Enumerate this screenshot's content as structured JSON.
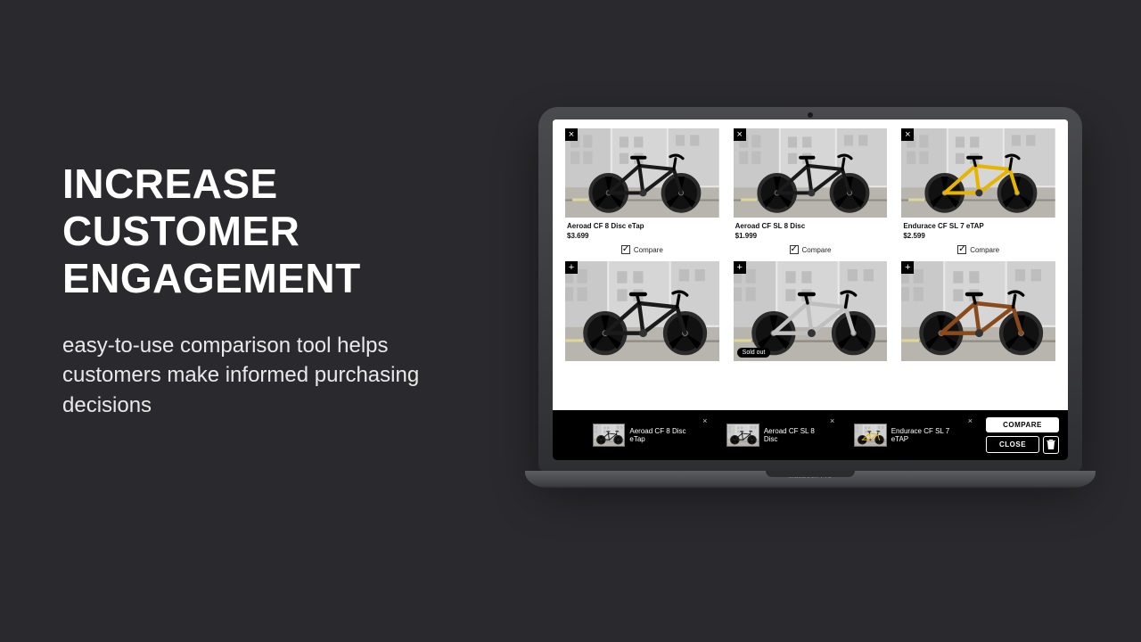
{
  "marketing": {
    "headline": "INCREASE CUSTOMER ENGAGEMENT",
    "subhead": "easy-to-use comparison tool helps customers make informed purchasing decisions"
  },
  "device": {
    "brand": "MacBook Pro"
  },
  "products": [
    {
      "name": "Aeroad CF 8 Disc eTap",
      "price": "$3.699",
      "selected": true,
      "compare_label": "Compare",
      "corner": "×",
      "accent": "#1a1a1a"
    },
    {
      "name": "Aeroad CF SL 8 Disc",
      "price": "$1.999",
      "selected": true,
      "compare_label": "Compare",
      "corner": "×",
      "accent": "#1a1a1a"
    },
    {
      "name": "Endurace CF SL 7 eTAP",
      "price": "$2.599",
      "selected": true,
      "compare_label": "Compare",
      "corner": "×",
      "accent": "#e7b400"
    },
    {
      "name": "",
      "price": "",
      "selected": false,
      "compare_label": "",
      "corner": "+",
      "accent": "#1a1a1a"
    },
    {
      "name": "",
      "price": "",
      "selected": false,
      "compare_label": "",
      "corner": "+",
      "accent": "#bfbfbf",
      "badge": "Sold out"
    },
    {
      "name": "",
      "price": "",
      "selected": false,
      "compare_label": "",
      "corner": "+",
      "accent": "#8a4a1a"
    }
  ],
  "compare_bar": {
    "items": [
      {
        "label": "Aeroad CF 8 Disc eTap",
        "accent": "#1a1a1a"
      },
      {
        "label": "Aeroad CF SL 8 Disc",
        "accent": "#1a1a1a"
      },
      {
        "label": "Endurace CF SL 7 eTAP",
        "accent": "#e7b400"
      }
    ],
    "compare_btn": "COMPARE",
    "close_btn": "CLOSE"
  }
}
